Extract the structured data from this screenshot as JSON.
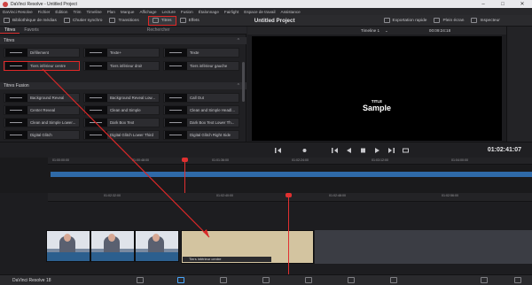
{
  "window": {
    "title": "DaVinci Resolve - Untitled Project"
  },
  "menu": [
    "DaVinci Resolve",
    "Fichier",
    "Édition",
    "Trim",
    "Timeline",
    "Plan",
    "Marque",
    "Affichage",
    "Lecture",
    "Fusion",
    "Étalonnage",
    "Fairlight",
    "Espace de travail",
    "Assistance"
  ],
  "toolbar": {
    "media": "Bibliothèque de médias",
    "sync": "Chutier synchro",
    "transitions": "Transitions",
    "titres": "Titres",
    "effets": "Effets",
    "project_title": "Untitled Project",
    "export": "Exportation rapide",
    "fullscreen": "Plein écran",
    "inspector": "Inspecteur"
  },
  "effects_panel": {
    "tabs": [
      "Titres",
      "Favoris"
    ],
    "search": "Rechercher",
    "section_titles": "Titres",
    "section_fusion": "Titres Fusion",
    "titles": [
      "Défilement",
      "Texte+",
      "Texte",
      "Tiers inférieur centre",
      "Tiers inférieur droit",
      "Tiers inférieur gauche"
    ],
    "fusion_titles": [
      "Background Reveal",
      "Background Reveal Low...",
      "Call Out",
      "Center Reveal",
      "Clean and Simple",
      "Clean and Simple Headl...",
      "Clean and Simple Lower...",
      "Dark Box Text",
      "Dark Box Text Lower Th...",
      "Digital Glitch",
      "Digital Glitch Lower Third",
      "Digital Glitch Right Side"
    ]
  },
  "viewer": {
    "timeline_name": "Timeline 1",
    "timecode_head": "00:09:24:18",
    "title_small": "TITLE",
    "title_big": "Sample",
    "timecode": "01:02:41:07"
  },
  "timeline_upper": {
    "ticks": [
      "01:00:00:00",
      "01:00:48:00",
      "01:01:36:00",
      "01:02:24:00",
      "01:03:12:00",
      "01:04:00:00",
      "01:04:48:00"
    ]
  },
  "timeline_lower": {
    "ticks": [
      "01:02:32:00",
      "01:02:40:00",
      "01:02:48:00",
      "01:02:56:00",
      "01:03:04:00"
    ],
    "title_clip": "Tiers inférieur centre"
  },
  "statusbar": {
    "brand": "DaVinci Resolve 18"
  },
  "colors": {
    "accent": "#e02828",
    "playhead": "#e03030",
    "clip_blue": "#2f6aa8",
    "title_clip": "#d3c4a0"
  }
}
